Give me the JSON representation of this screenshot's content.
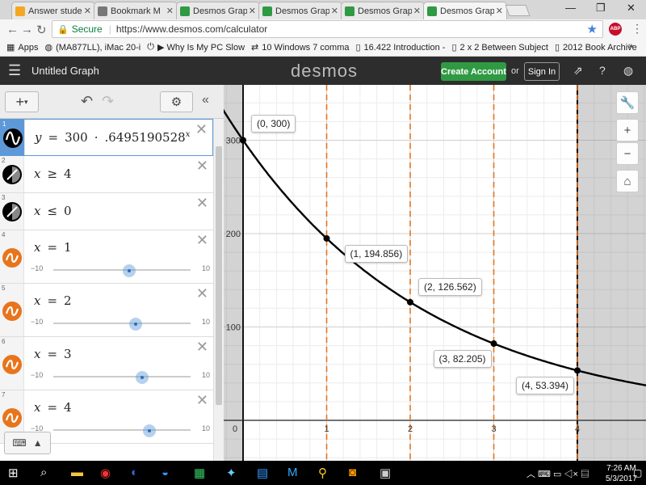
{
  "browser": {
    "tabs": [
      {
        "title": "Answer stude",
        "icon": "chegg-icon",
        "color": "#f5a623"
      },
      {
        "title": "Bookmark M",
        "icon": "star-icon",
        "color": "#777777"
      },
      {
        "title": "Desmos Grap",
        "icon": "desmos-icon",
        "color": "#2f9a43"
      },
      {
        "title": "Desmos Grap",
        "icon": "desmos-icon",
        "color": "#2f9a43"
      },
      {
        "title": "Desmos Grap",
        "icon": "desmos-icon",
        "color": "#2f9a43"
      },
      {
        "title": "Desmos Grap",
        "icon": "desmos-icon",
        "color": "#2f9a43"
      }
    ],
    "secure_label": "Secure",
    "url": "https://www.desmos.com/calculator",
    "abp_label": "ABP",
    "bookmarks": [
      {
        "label": "Apps",
        "icon": "apps-grid-icon"
      },
      {
        "label": "(MA877LL), iMac 20-i",
        "icon": "globe-icon"
      },
      {
        "label": "▶ Why Is My PC Slow",
        "icon": "power-icon"
      },
      {
        "label": "10 Windows 7 comma",
        "icon": "arrows-icon"
      },
      {
        "label": "16.422 Introduction -",
        "icon": "page-icon"
      },
      {
        "label": "2 x 2 Between Subject",
        "icon": "page-icon"
      },
      {
        "label": "2012 Book Archive",
        "icon": "page-icon"
      }
    ]
  },
  "desmos": {
    "graph_title": "Untitled Graph",
    "logo": "desmos",
    "create_account": "Create Account",
    "or": "or",
    "sign_in": "Sign In"
  },
  "expressions": [
    {
      "num": "1",
      "parts": [
        "y",
        "=",
        "300",
        "·",
        ".6495190528"
      ],
      "sup": "x",
      "type": "curve",
      "color": "#000000"
    },
    {
      "num": "2",
      "parts": [
        "x",
        "≥",
        "4"
      ],
      "type": "inequality",
      "color": "#000000"
    },
    {
      "num": "3",
      "parts": [
        "x",
        "≤",
        "0"
      ],
      "type": "inequality",
      "color": "#000000"
    },
    {
      "num": "4",
      "parts": [
        "x",
        "=",
        "1"
      ],
      "type": "line",
      "color": "#e8741c",
      "slider": {
        "min": "−10",
        "max": "10",
        "value": 1
      }
    },
    {
      "num": "5",
      "parts": [
        "x",
        "=",
        "2"
      ],
      "type": "line",
      "color": "#e8741c",
      "slider": {
        "min": "−10",
        "max": "10",
        "value": 2
      }
    },
    {
      "num": "6",
      "parts": [
        "x",
        "=",
        "3"
      ],
      "type": "line",
      "color": "#e8741c",
      "slider": {
        "min": "−10",
        "max": "10",
        "value": 3
      }
    },
    {
      "num": "7",
      "parts": [
        "x",
        "=",
        "4"
      ],
      "type": "line",
      "color": "#e8741c",
      "slider": {
        "min": "−10",
        "max": "10",
        "value": 4
      }
    }
  ],
  "graph": {
    "x_ticks": [
      "0",
      "1",
      "2",
      "3",
      "4"
    ],
    "y_ticks": [
      "100",
      "200",
      "300"
    ],
    "points": [
      {
        "x": 0,
        "y": 300,
        "label": "(0, 300)"
      },
      {
        "x": 1,
        "y": 194.856,
        "label": "(1, 194.856)"
      },
      {
        "x": 2,
        "y": 126.562,
        "label": "(2, 126.562)"
      },
      {
        "x": 3,
        "y": 82.205,
        "label": "(3, 82.205)"
      },
      {
        "x": 4,
        "y": 53.394,
        "label": "(4, 53.394)"
      }
    ],
    "vertical_lines": [
      1,
      2,
      3,
      4
    ],
    "curve_color": "#000000",
    "line_color": "#e8741c",
    "shade_color": "#808080",
    "xlim": [
      -0.2,
      4.8
    ],
    "ylim": [
      -50,
      330
    ]
  },
  "taskbar": {
    "time": "7:26 AM",
    "date": "5/3/2017"
  }
}
